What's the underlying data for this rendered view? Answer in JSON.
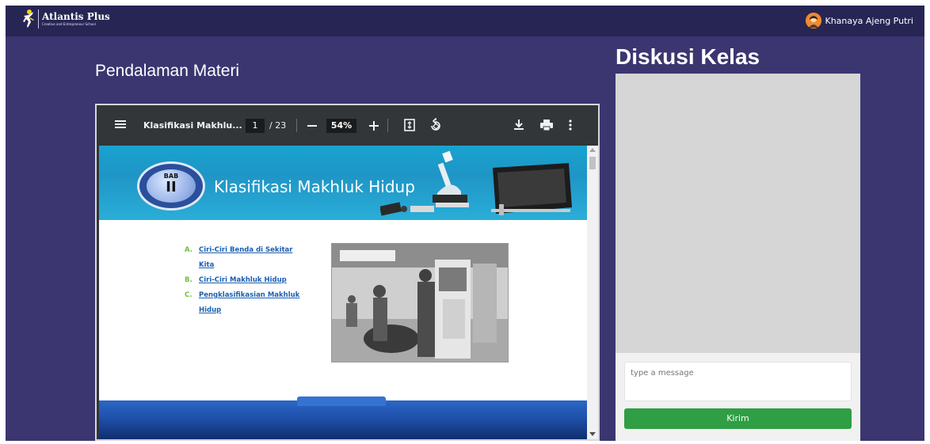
{
  "brand": {
    "name": "Atlantis Plus",
    "tagline": "Creative and Entrepreneur School"
  },
  "user": {
    "name": "Khanaya Ajeng Putri"
  },
  "main": {
    "section_title": "Pendalaman Materi"
  },
  "pdf_viewer": {
    "doc_title": "Klasifikasi Makhlu...",
    "current_page": "1",
    "total_pages": "/ 23",
    "zoom": "54%",
    "page": {
      "badge_label": "BAB",
      "badge_number": "II",
      "chapter_title": "Klasifikasi Makhluk Hidup",
      "toc": [
        {
          "letter": "A.",
          "text": "Ciri-Ciri Benda di Sekitar Kita"
        },
        {
          "letter": "B.",
          "text": "Ciri-Ciri Makhluk Hidup"
        },
        {
          "letter": "C.",
          "text": "Pengklasifikasian Makhluk Hidup"
        }
      ]
    }
  },
  "discussion": {
    "title": "Diskusi Kelas",
    "input_placeholder": "type a message",
    "send_label": "Kirim"
  },
  "colors": {
    "page_bg": "#3b3670",
    "topbar_bg": "#272553",
    "send_button": "#2f9e44",
    "link": "#1c5fb2"
  }
}
